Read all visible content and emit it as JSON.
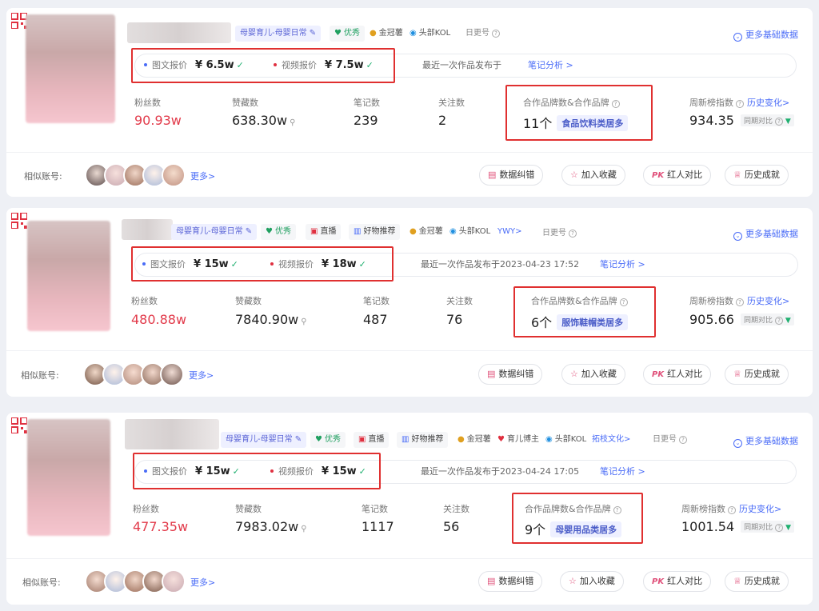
{
  "common": {
    "image_text_label": "图文报价",
    "video_label": "视频报价",
    "note_link": "笔记分析 >",
    "fans_label": "粉丝数",
    "likes_label": "赞藏数",
    "notes_label": "笔记数",
    "follow_label": "关注数",
    "brand_label": "合作品牌数&合作品牌",
    "weekly_label": "周新榜指数",
    "history_link": "历史变化>",
    "compare_label": "同期对比",
    "more_data": "更多基础数据",
    "similar_label": "相似账号:",
    "more_similar": "更多>",
    "btn_correct": "数据纠错",
    "btn_collect": "加入收藏",
    "btn_compare": "红人对比",
    "btn_history": "历史成就",
    "icon_names": [
      "qr-code-icon",
      "heart-shield-icon",
      "crown-icon",
      "kol-icon",
      "live-icon",
      "gift-icon",
      "edit-icon",
      "help-icon",
      "search-icon",
      "chevron-down-circle-icon",
      "star-icon",
      "pk-icon",
      "trophy-icon",
      "correct-doc-icon"
    ],
    "colors": {
      "accent": "#4a6cf7",
      "red": "#e23a4a",
      "highlight_box": "#e03030",
      "green": "#20b070"
    }
  },
  "cards": [
    {
      "category": "母婴育儿-母婴日常",
      "badges": [
        "优秀",
        "金冠薯",
        "头部KOL"
      ],
      "extra_badges": [],
      "daily": "日更号",
      "image_price": "¥ 6.5w",
      "video_price": "¥ 7.5w",
      "last_pub": "最近一次作品发布于",
      "fans": "90.93w",
      "likes": "638.30w",
      "notes": "239",
      "follow": "2",
      "brand_count": "11个",
      "brand_cat": "食品饮料类居多",
      "weekly": "934.35"
    },
    {
      "category": "母婴育儿-母婴日常",
      "badges": [
        "优秀",
        "直播",
        "好物推荐",
        "金冠薯",
        "头部KOL"
      ],
      "extra_badges": [
        "YWY>"
      ],
      "daily": "日更号",
      "image_price": "¥ 15w",
      "video_price": "¥ 18w",
      "last_pub": "最近一次作品发布于2023-04-23 17:52",
      "fans": "480.88w",
      "likes": "7840.90w",
      "notes": "487",
      "follow": "76",
      "brand_count": "6个",
      "brand_cat": "服饰鞋帽类居多",
      "weekly": "905.66"
    },
    {
      "category": "母婴育儿-母婴日常",
      "badges": [
        "优秀",
        "直播",
        "好物推荐",
        "金冠薯",
        "育儿博主",
        "头部KOL"
      ],
      "extra_badges": [
        "拓枝文化>"
      ],
      "daily": "日更号",
      "image_price": "¥ 15w",
      "video_price": "¥ 15w",
      "last_pub": "最近一次作品发布于2023-04-24 17:05",
      "fans": "477.35w",
      "likes": "7983.02w",
      "notes": "1117",
      "follow": "56",
      "brand_count": "9个",
      "brand_cat": "母婴用品类居多",
      "weekly": "1001.54"
    }
  ]
}
